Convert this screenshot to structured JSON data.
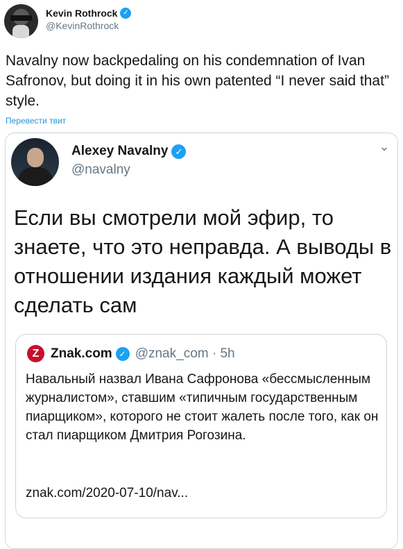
{
  "tweet": {
    "author_name": "Kevin Rothrock",
    "author_handle": "@KevinRothrock",
    "text": "Navalny now backpedaling on his condemnation of Ivan Safronov, but doing it in his own patented “I never said that” style.",
    "translate_label": "Перевести твит"
  },
  "embedded": {
    "author_name": "Alexey Navalny",
    "author_handle": "@navalny",
    "text": "Если вы смотрели мой эфир, то знаете, что это неправда. А выводы в отношении издания каждый может сделать сам"
  },
  "quoted": {
    "logo_letter": "Z",
    "author_name": "Znak.com",
    "meta": "@znak_com · 5h",
    "text": "Навальный назвал Ивана Сафронова «бессмысленным журналистом», ставшим «типичным государственным пиарщиком», которого не стоит жалеть после того, как он стал пиарщиком Дмитрия Рогозина.",
    "link": "znak.com/2020-07-10/nav..."
  },
  "icons": {
    "verified": "✓",
    "chevron": "⌄"
  },
  "colors": {
    "verified_blue": "#1da1f2",
    "link_blue": "#1b95e0",
    "znak_red": "#c8102e",
    "secondary_text": "#657786",
    "border": "#ccd6dd"
  }
}
